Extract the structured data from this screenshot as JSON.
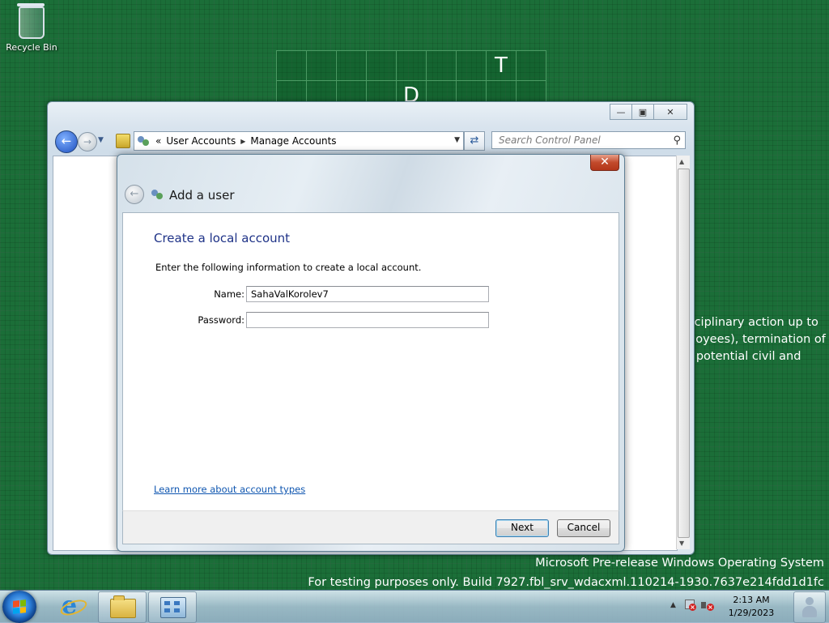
{
  "desktop": {
    "recycle_bin_label": "Recycle Bin",
    "puzzle_letters": [
      "T",
      "D"
    ],
    "background_message": [
      "isciplinary action up to",
      "ployees), termination of",
      "d potential civil and"
    ],
    "watermark_line1": "Microsoft Pre-release Windows Operating System",
    "watermark_line2": "For testing purposes only. Build 7927.fbl_srv_wdacxml.110214-1930.7637e214fdd1d1fc"
  },
  "control_panel": {
    "breadcrumb_overflow": "«",
    "breadcrumbs": [
      "User Accounts",
      "Manage Accounts"
    ],
    "search_placeholder": "Search Control Panel"
  },
  "dialog": {
    "title": "Add a user",
    "heading": "Create a local account",
    "instructions": "Enter the following information to create a local account.",
    "name_label": "Name:",
    "name_value": "SahaValKorolev7",
    "password_label": "Password:",
    "password_value": "",
    "learn_more_link": "Learn more about account types",
    "next_button": "Next",
    "cancel_button": "Cancel"
  },
  "taskbar": {
    "time": "2:13 AM",
    "date": "1/29/2023"
  },
  "colors": {
    "desktop_bg": "#1b6e38",
    "heading_blue": "#1e3287",
    "link_blue": "#0f56b0",
    "close_red": "#c24a2c"
  }
}
